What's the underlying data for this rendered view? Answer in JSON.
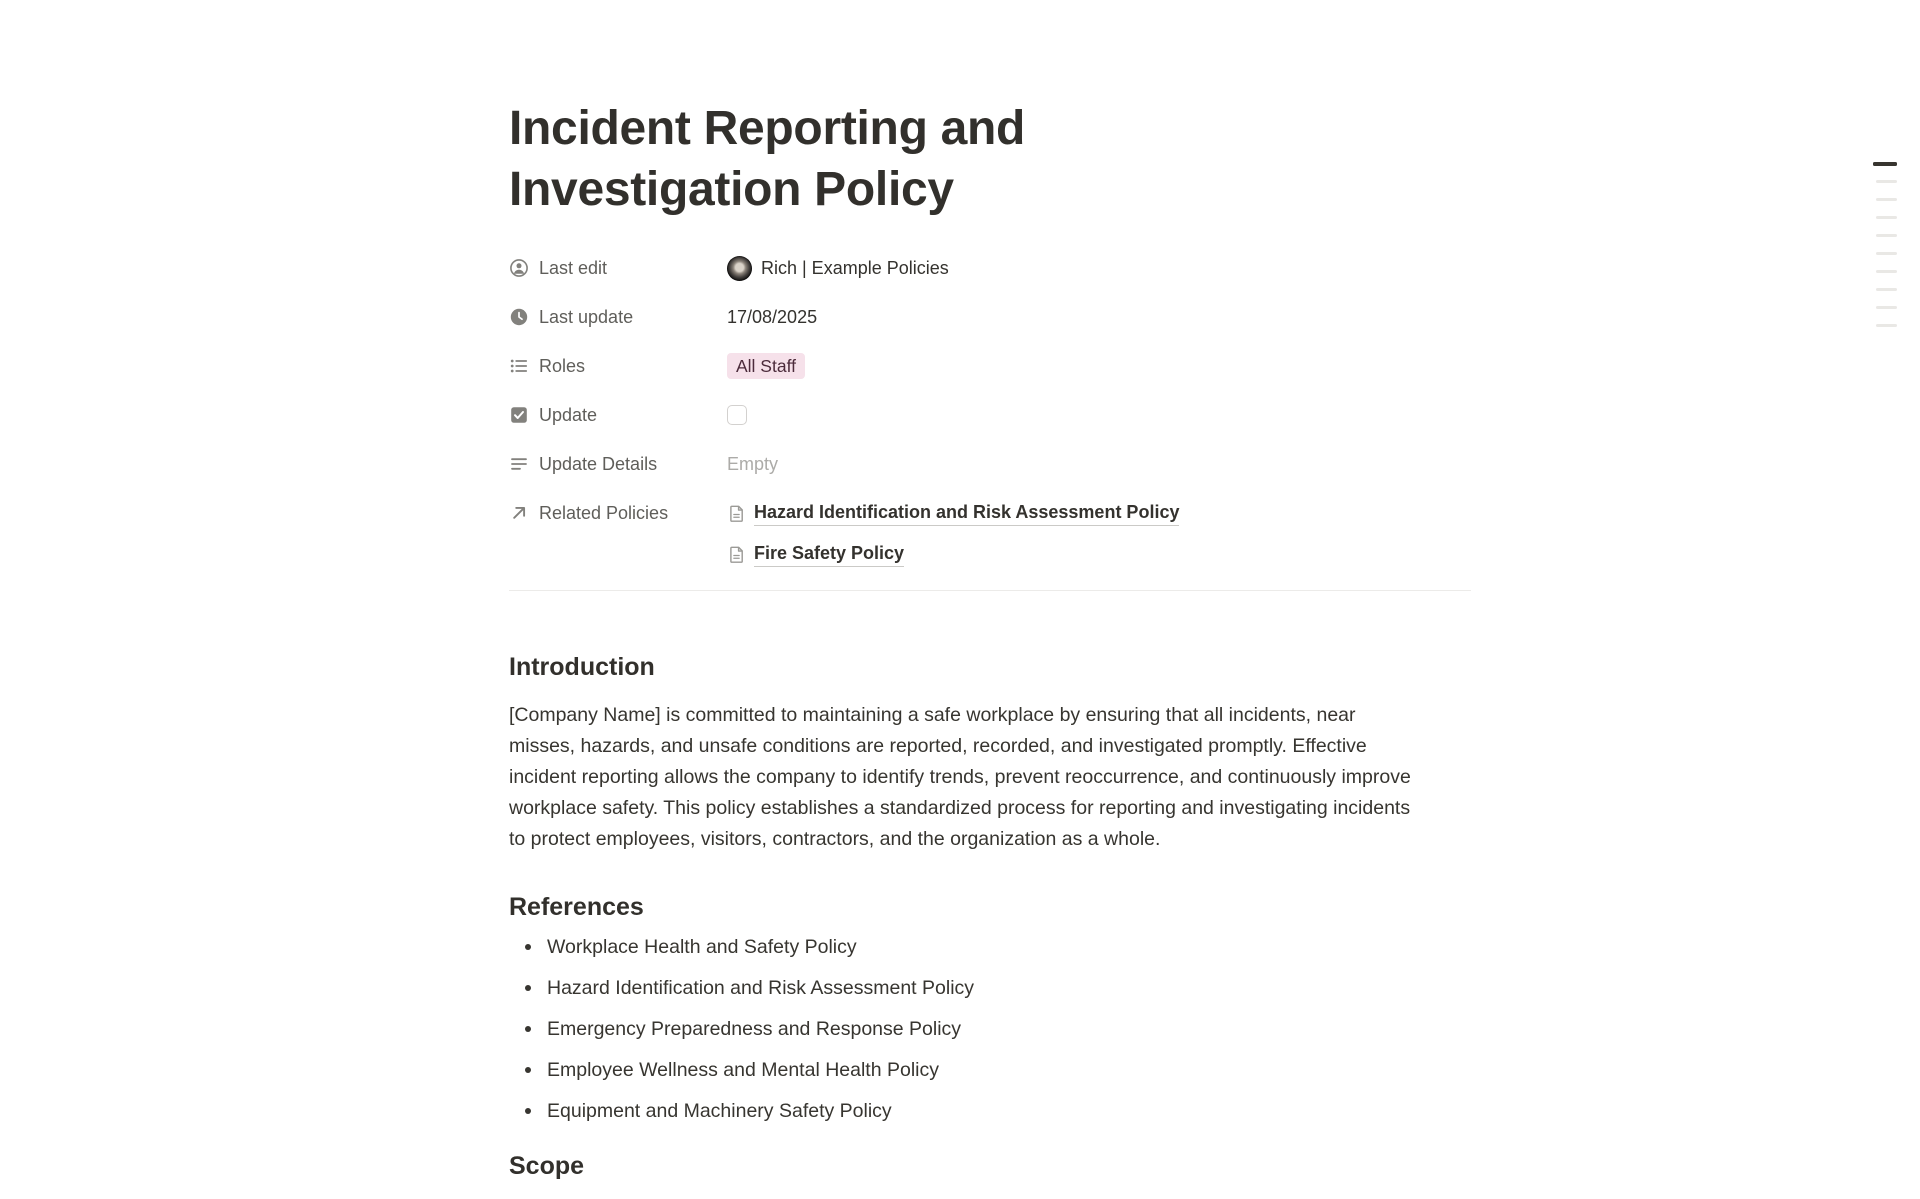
{
  "doc": {
    "title": "Incident Reporting and Investigation Policy",
    "properties": [
      {
        "label": "Last edit",
        "icon": "person-circle-icon",
        "kind": "person",
        "value": "Rich | Example Policies"
      },
      {
        "label": "Last update",
        "icon": "clock-icon",
        "kind": "date",
        "value": "17/08/2025"
      },
      {
        "label": "Roles",
        "icon": "bulleted-list-icon",
        "kind": "tag",
        "value": "All Staff"
      },
      {
        "label": "Update",
        "icon": "checkbox-icon",
        "kind": "checkbox",
        "checked": false
      },
      {
        "label": "Update Details",
        "icon": "text-lines-icon",
        "kind": "placeholder",
        "value": "Empty"
      },
      {
        "label": "Related Policies",
        "icon": "arrow-up-right-icon",
        "kind": "page-links",
        "links": [
          {
            "label": "Hazard Identification and Risk Assessment Policy"
          },
          {
            "label": "Fire Safety Policy"
          }
        ]
      }
    ],
    "sections": {
      "introduction": {
        "heading": "Introduction",
        "paragraph": "[Company Name] is committed to maintaining a safe workplace by ensuring that all incidents, near misses, hazards, and unsafe conditions are reported, recorded, and investigated promptly. Effective incident reporting allows the company to identify trends, prevent reoccurrence, and continuously improve workplace safety. This policy establishes a standardized process for reporting and investigating incidents to protect employees, visitors, contractors, and the organization as a whole."
      },
      "references": {
        "heading": "References",
        "items": [
          "Workplace Health and Safety Policy",
          "Hazard Identification and Risk Assessment Policy",
          "Emergency Preparedness and Response Policy",
          "Employee Wellness and Mental Health Policy",
          "Equipment and Machinery Safety Policy"
        ]
      },
      "scope": {
        "heading": "Scope"
      }
    }
  },
  "toc": {
    "bar_count": 10,
    "active_index": 0
  },
  "colors": {
    "title_text": "#32302C",
    "body_text": "#373530",
    "property_label": "#5F5E5A",
    "property_icon": "#82817D",
    "placeholder": "#ACABA8",
    "tag_background": "#F6E1EA",
    "tag_text": "#4C2B3B",
    "divider": "#ECEBE9",
    "toc_active": "#37352F",
    "toc_inactive": "#E9E8E5"
  }
}
